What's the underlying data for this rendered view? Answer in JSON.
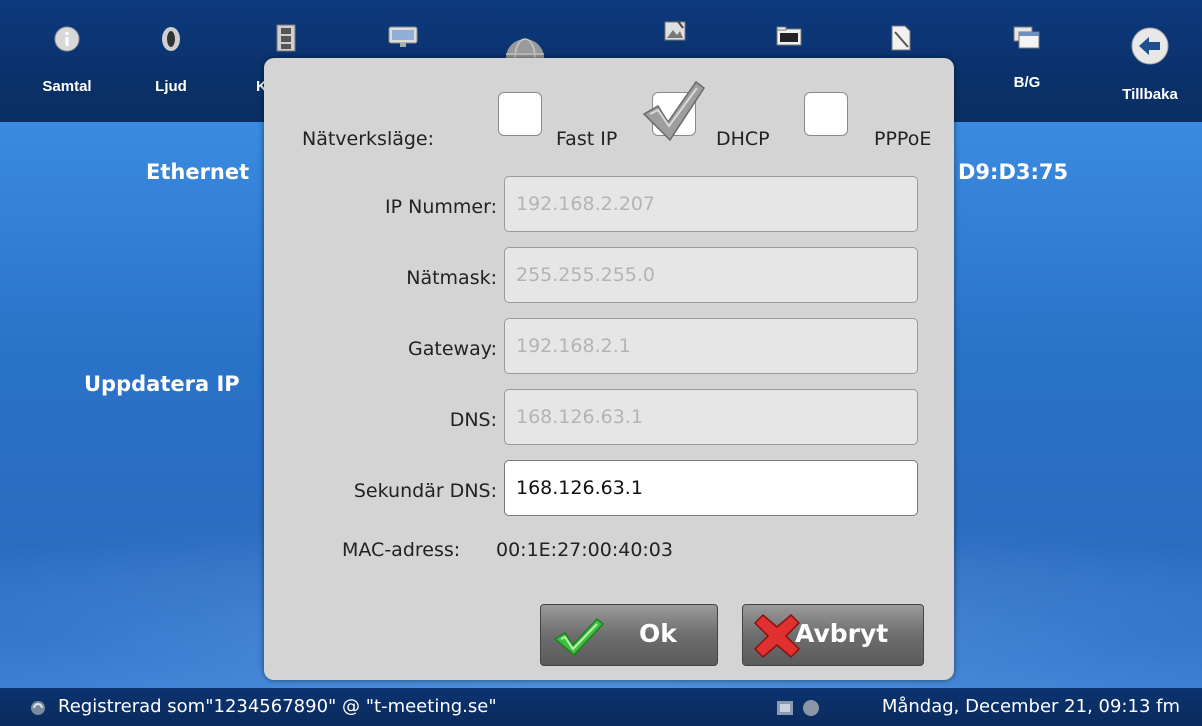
{
  "toolbar": {
    "items": [
      {
        "label": "Samtal",
        "icon": "info-icon"
      },
      {
        "label": "Ljud",
        "icon": "speaker-icon"
      },
      {
        "label": "K",
        "icon": "film-icon"
      },
      {
        "label": "",
        "icon": "monitor-icon"
      },
      {
        "label": "",
        "icon": "globe-icon"
      },
      {
        "label": "",
        "icon": "picture-icon"
      },
      {
        "label": "",
        "icon": "folder-icon"
      },
      {
        "label": "",
        "icon": "document-icon"
      },
      {
        "label": "B/G",
        "icon": "windows-icon"
      },
      {
        "label": "Tillbaka",
        "icon": "back-arrow-icon"
      }
    ]
  },
  "background": {
    "ethernet_text": "Ethernet",
    "mac_fragment": "D9:D3:75",
    "update_ip_text": "Uppdatera IP"
  },
  "dialog": {
    "network_mode_label": "Nätverksläge:",
    "modes": [
      {
        "label": "Fast IP",
        "checked": false
      },
      {
        "label": "DHCP",
        "checked": true
      },
      {
        "label": "PPPoE",
        "checked": false
      }
    ],
    "fields": [
      {
        "label": "IP Nummer:",
        "value": "192.168.2.207",
        "enabled": false
      },
      {
        "label": "Nätmask:",
        "value": "255.255.255.0",
        "enabled": false
      },
      {
        "label": "Gateway:",
        "value": "192.168.2.1",
        "enabled": false
      },
      {
        "label": "DNS:",
        "value": "168.126.63.1",
        "enabled": false
      },
      {
        "label": "Sekundär DNS:",
        "value": "168.126.63.1",
        "enabled": true
      }
    ],
    "mac_label": "MAC-adress:",
    "mac_value": "00:1E:27:00:40:03",
    "ok_label": "Ok",
    "cancel_label": "Avbryt"
  },
  "statusbar": {
    "registration": "Registrerad som\"1234567890\" @ \"t-meeting.se\"",
    "datetime": "Måndag, December 21, 09:13 fm"
  },
  "colors": {
    "toolbar_bg": "#0a3068",
    "panel_bg": "#2a6fc4",
    "dialog_bg": "#d4d4d4",
    "checkmark_green": "#3fbf3f",
    "cancel_red": "#e03030"
  }
}
